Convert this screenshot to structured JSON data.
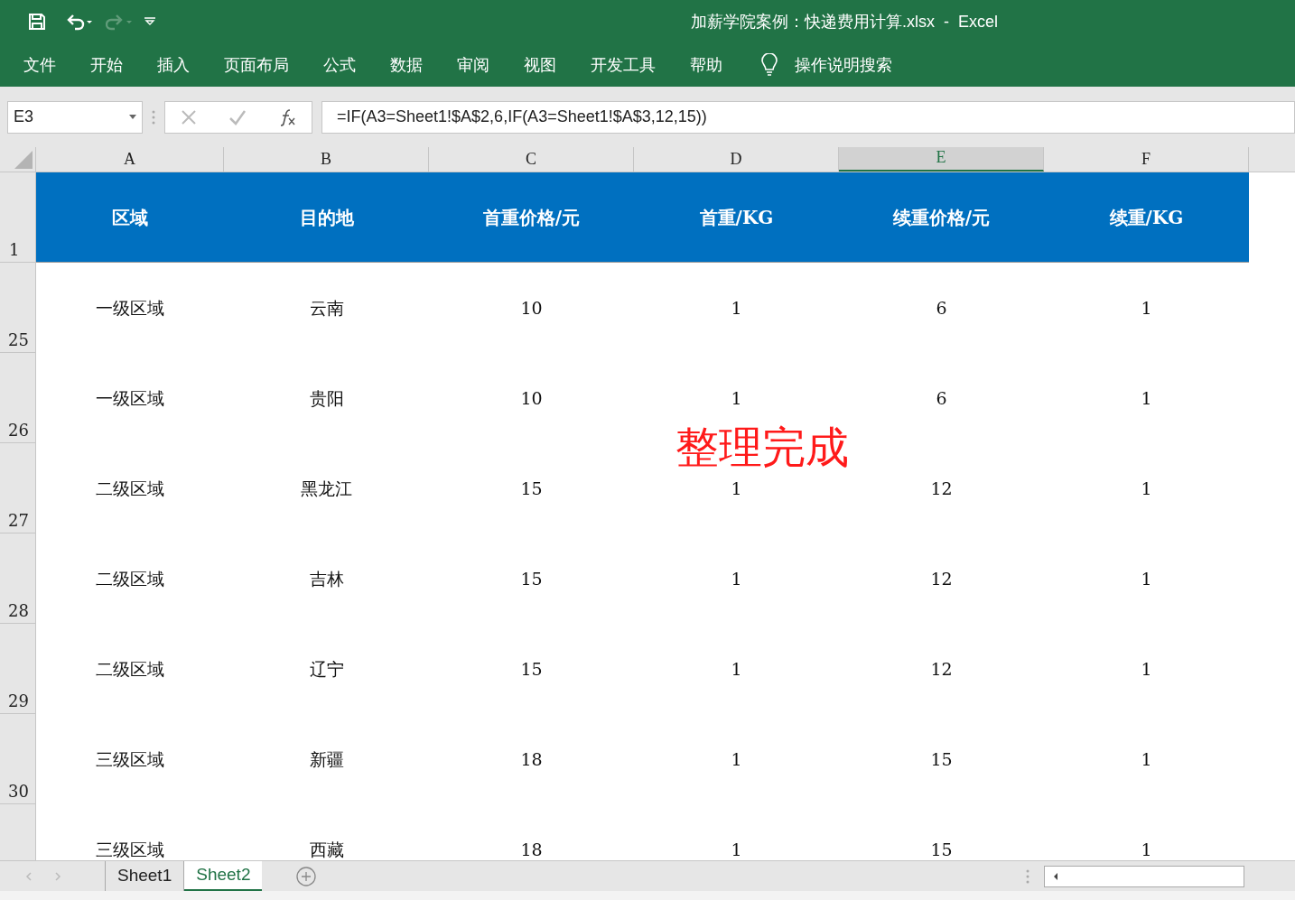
{
  "window": {
    "title": "加薪学院案例：快递费用计算.xlsx  -  Excel"
  },
  "menu": [
    {
      "label": "文件"
    },
    {
      "label": "开始"
    },
    {
      "label": "插入"
    },
    {
      "label": "页面布局"
    },
    {
      "label": "公式"
    },
    {
      "label": "数据"
    },
    {
      "label": "审阅"
    },
    {
      "label": "视图"
    },
    {
      "label": "开发工具"
    },
    {
      "label": "帮助"
    }
  ],
  "search": {
    "placeholder": "操作说明搜索"
  },
  "name_box": "E3",
  "formula": "=IF(A3=Sheet1!$A$2,6,IF(A3=Sheet1!$A$3,12,15))",
  "columns": [
    {
      "label": "A",
      "selected": false
    },
    {
      "label": "B",
      "selected": false
    },
    {
      "label": "C",
      "selected": false
    },
    {
      "label": "D",
      "selected": false
    },
    {
      "label": "E",
      "selected": true
    },
    {
      "label": "F",
      "selected": false
    }
  ],
  "header_row": {
    "number": "1",
    "cells": [
      "区域",
      "目的地",
      "首重价格/元",
      "首重/KG",
      "续重价格/元",
      "续重/KG"
    ]
  },
  "rows": [
    {
      "number": "25",
      "cells": [
        "一级区域",
        "云南",
        "10",
        "1",
        "6",
        "1"
      ]
    },
    {
      "number": "26",
      "cells": [
        "一级区域",
        "贵阳",
        "10",
        "1",
        "6",
        "1"
      ]
    },
    {
      "number": "27",
      "cells": [
        "二级区域",
        "黑龙江",
        "15",
        "1",
        "12",
        "1"
      ]
    },
    {
      "number": "28",
      "cells": [
        "二级区域",
        "吉林",
        "15",
        "1",
        "12",
        "1"
      ]
    },
    {
      "number": "29",
      "cells": [
        "二级区域",
        "辽宁",
        "15",
        "1",
        "12",
        "1"
      ]
    },
    {
      "number": "30",
      "cells": [
        "三级区域",
        "新疆",
        "18",
        "1",
        "15",
        "1"
      ]
    },
    {
      "cells": [
        "三级区域",
        "西藏",
        "18",
        "1",
        "15",
        "1"
      ]
    }
  ],
  "overlay_text": "整理完成",
  "sheets": [
    {
      "label": "Sheet1",
      "selected": false
    },
    {
      "label": "Sheet2",
      "selected": true
    }
  ]
}
